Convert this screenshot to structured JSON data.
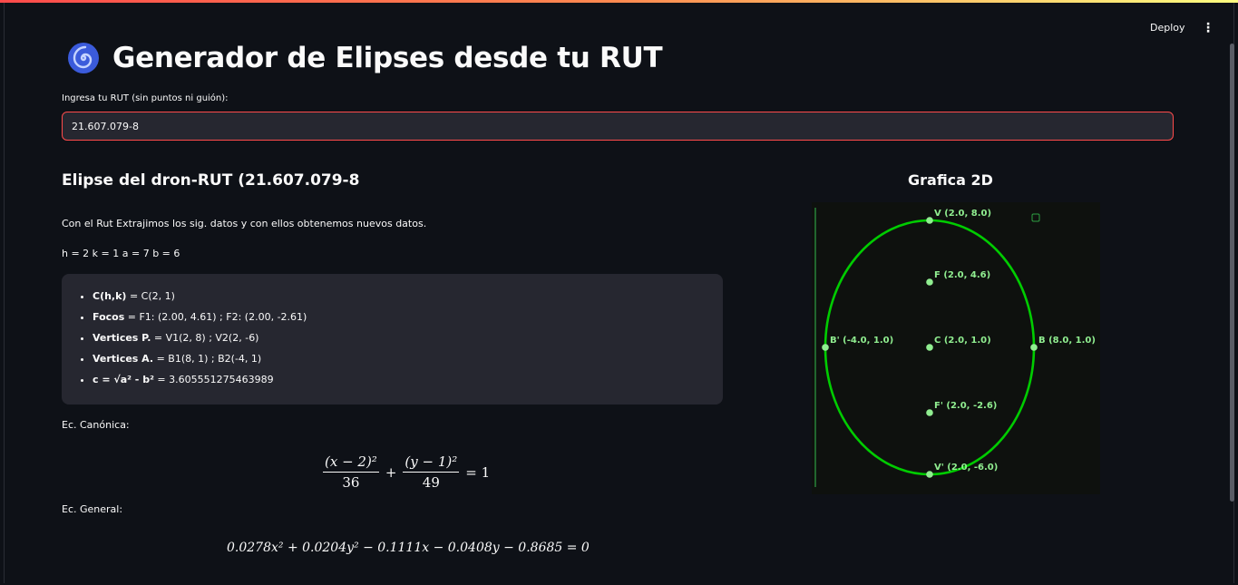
{
  "header": {
    "deploy_label": "Deploy",
    "menu_icon": "⋮"
  },
  "page": {
    "title": "Generador de Elipses desde tu RUT",
    "title_icon": "spiral-icon",
    "input_label": "Ingresa tu RUT (sin puntos ni guión):",
    "input_value": "21.607.079-8"
  },
  "result": {
    "heading": "Elipse del dron-RUT (21.607.079-8",
    "intro": "Con el Rut Extrajimos los sig. datos y con ellos obtenemos nuevos datos.",
    "params": "h = 2 k = 1 a = 7 b = 6",
    "items": [
      {
        "key": "C(h,k)",
        "value": " = C(2, 1)"
      },
      {
        "key": "Focos",
        "value": " = F1: (2.00, 4.61) ; F2: (2.00, -2.61)"
      },
      {
        "key": "Vertices P.",
        "value": " = V1(2, 8) ; V2(2, -6)"
      },
      {
        "key": "Vertices A.",
        "value": " = B1(8, 1) ; B2(-4, 1)"
      },
      {
        "key": "c = √a² - b²",
        "value": " = 3.605551275463989"
      }
    ],
    "canonical_label": "Ec. Canónica:",
    "canonical": {
      "num1": "(x − 2)²",
      "den1": "36",
      "plus": "+",
      "num2": "(y − 1)²",
      "den2": "49",
      "rhs": "= 1"
    },
    "general_label": "Ec. General:",
    "general": "0.0278x² + 0.0204y² − 0.1111x − 0.0408y − 0.8685 = 0"
  },
  "graph": {
    "title": "Grafica 2D",
    "ellipse_color": "#00cc00",
    "point_color": "#90ee90",
    "axis_color": "#2ea043",
    "points": [
      {
        "id": "V",
        "label": "V (2.0, 8.0)"
      },
      {
        "id": "F",
        "label": "F (2.0, 4.6)"
      },
      {
        "id": "Bp",
        "label": "B' (-4.0, 1.0)"
      },
      {
        "id": "C",
        "label": "C (2.0, 1.0)"
      },
      {
        "id": "B",
        "label": "B (8.0, 1.0)"
      },
      {
        "id": "Fp",
        "label": "F' (2.0, -2.6)"
      },
      {
        "id": "Vp",
        "label": "V' (2.0, -6.0)"
      }
    ]
  }
}
